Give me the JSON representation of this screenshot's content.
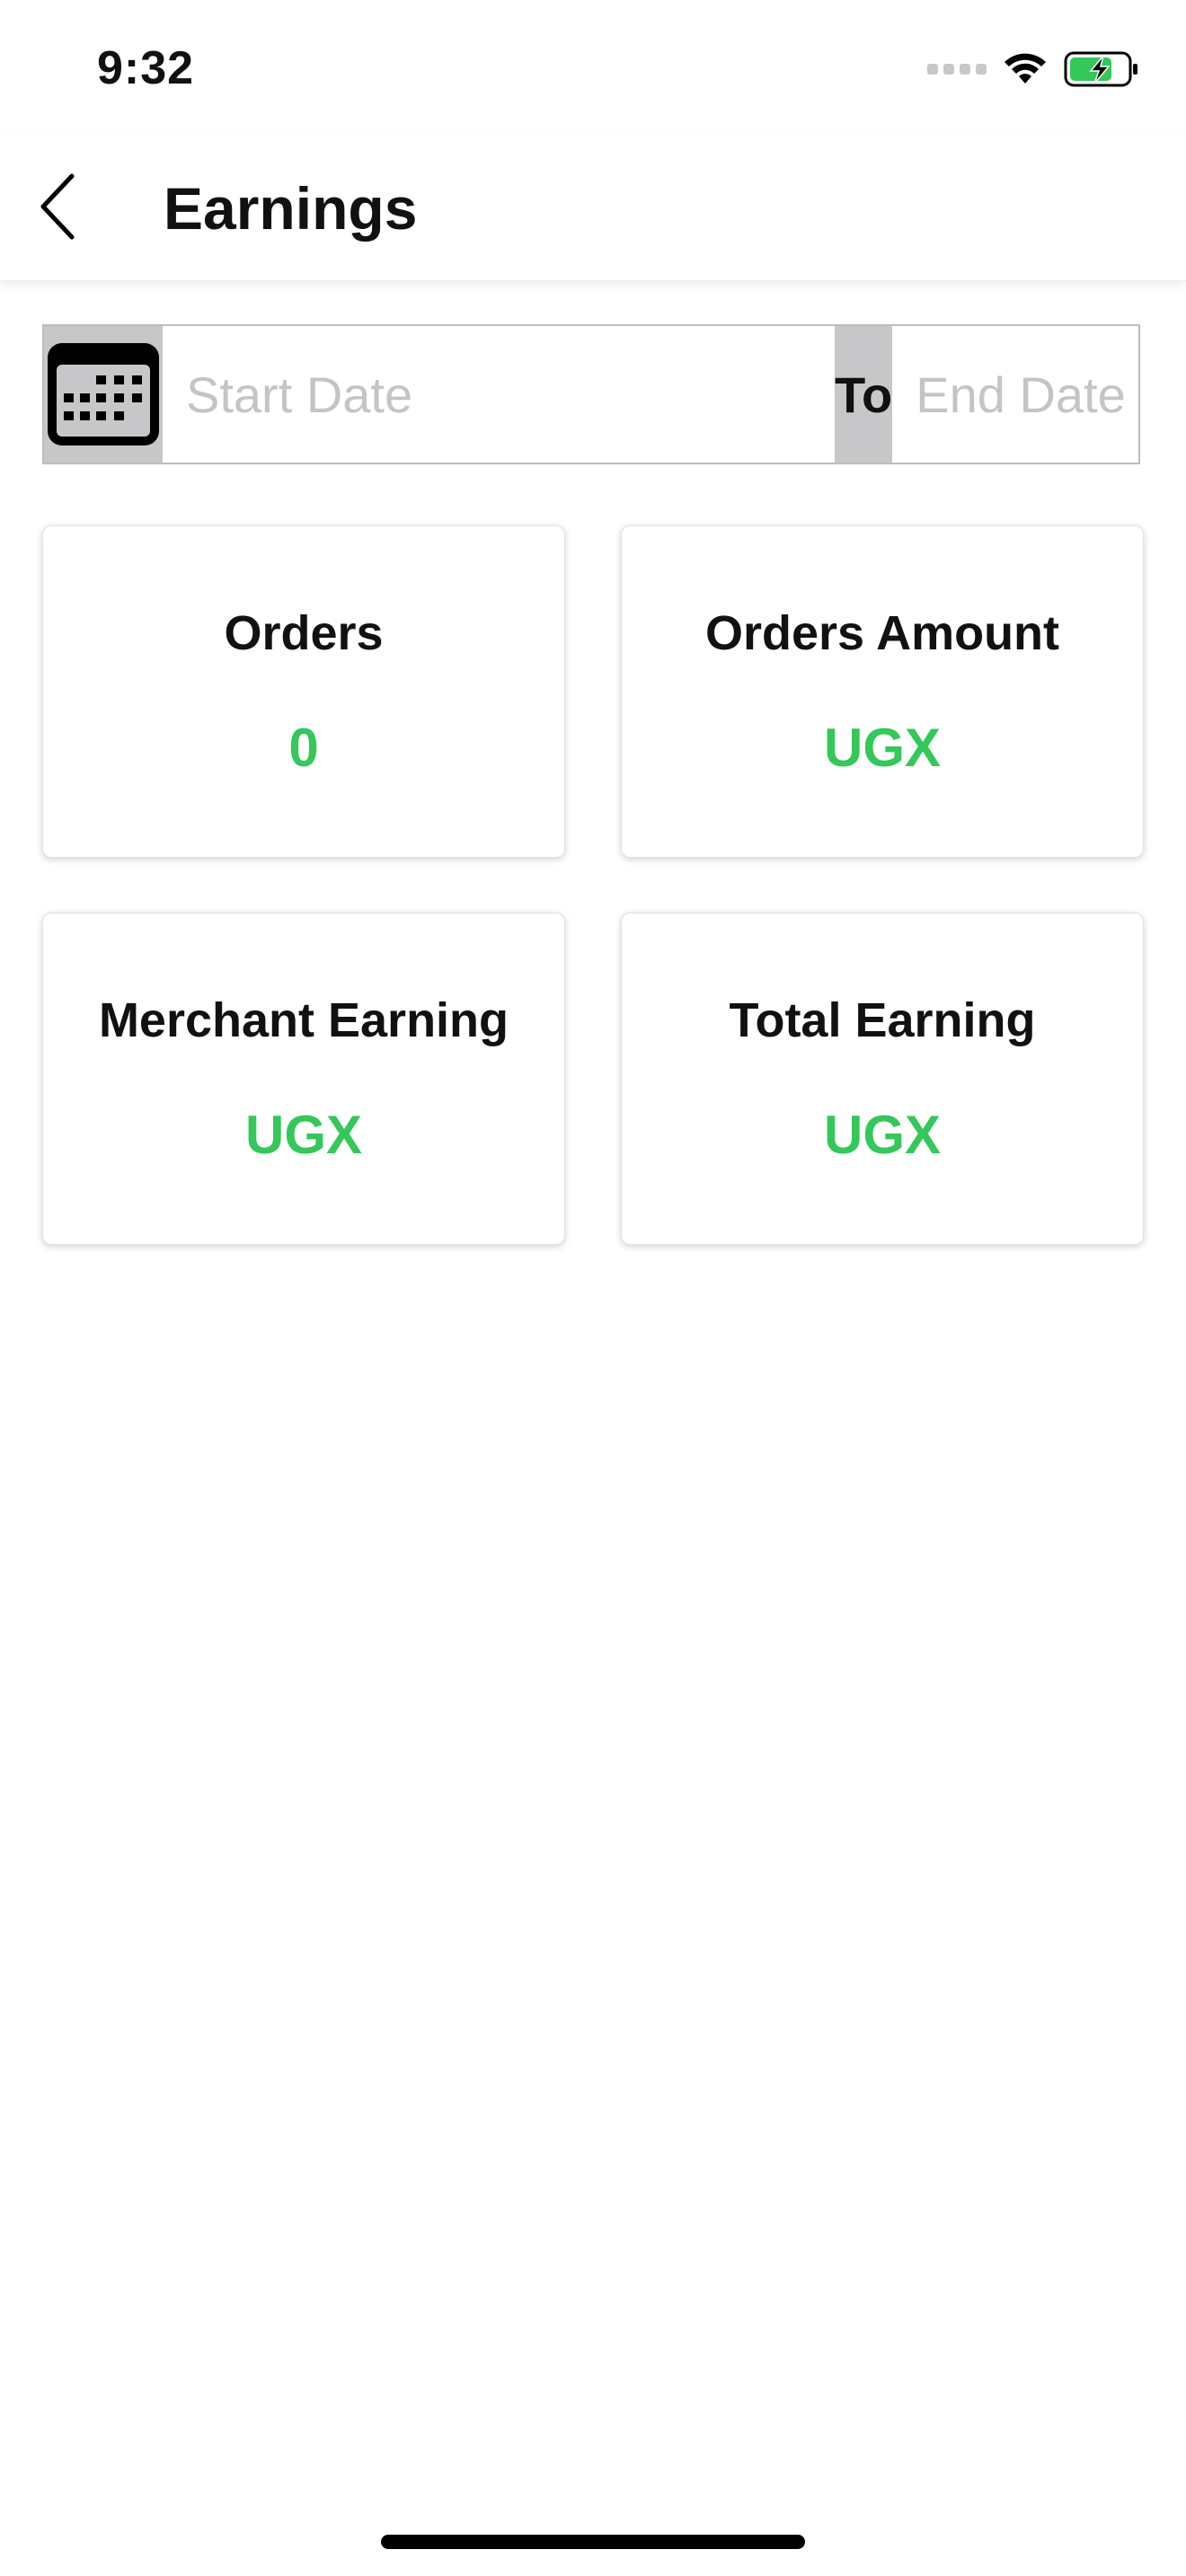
{
  "status_bar": {
    "time": "9:32"
  },
  "header": {
    "title": "Earnings",
    "back_icon": "chevron-left-icon"
  },
  "date_range": {
    "calendar_icon": "calendar-icon",
    "start_placeholder": "Start Date",
    "separator_label": "To",
    "end_placeholder": "End Date"
  },
  "cards": [
    {
      "title": "Orders",
      "value": "0"
    },
    {
      "title": "Orders Amount",
      "value": "UGX"
    },
    {
      "title": "Merchant Earning",
      "value": "UGX"
    },
    {
      "title": "Total Earning",
      "value": "UGX"
    }
  ],
  "colors": {
    "value_green": "#34c759",
    "segment_gray": "#c7c7c9",
    "battery_green": "#34c759"
  }
}
